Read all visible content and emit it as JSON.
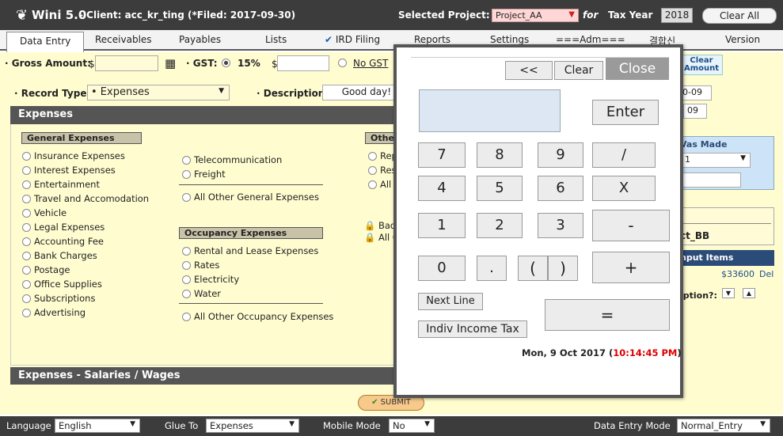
{
  "window": {
    "app_title": "Wini 5.0",
    "client_text": "- Client: acc_kr_ting (*Filed: 2017-09-30)",
    "selected_project_label": "Selected Project:",
    "selected_project_value": "Project_AA",
    "for_label": "for",
    "tax_year_label": "Tax Year",
    "tax_year_value": "2018",
    "clear_all_label": "Clear All"
  },
  "tabs": [
    {
      "label": "Data Entry"
    },
    {
      "label": "Receivables"
    },
    {
      "label": "Payables"
    },
    {
      "label": "Lists"
    },
    {
      "label": "IRD Filing"
    },
    {
      "label": "Reports"
    },
    {
      "label": "Settings"
    },
    {
      "label": "===Adm==="
    },
    {
      "label": "결합신"
    },
    {
      "label": "Version"
    }
  ],
  "form": {
    "gross_amount_label": "· Gross Amount:",
    "currency": "$",
    "gst_label": "· GST:",
    "gst_rate": "15%",
    "no_gst_label": "No GST",
    "clear_amount_label": "Clear Amount",
    "record_type_label": "· Record Type",
    "record_type_value": "• Expenses",
    "description_label": "· Description",
    "description_value": "Good day!"
  },
  "expenses": {
    "header": "Expenses",
    "general_header": "General Expenses",
    "general_col1": [
      "Insurance Expenses",
      "Interest Expenses",
      "Entertainment",
      "Travel and Accomodation",
      "Vehicle",
      "Legal Expenses",
      "Accounting Fee",
      "Bank Charges",
      "Postage",
      "Office Supplies",
      "Subscriptions",
      "Advertising"
    ],
    "general_col2": [
      "Telecommunication",
      "Freight"
    ],
    "all_other_general": "All Other General Expenses",
    "occupancy_header": "Occupancy Expenses",
    "occupancy_items": [
      "Rental and Lease Expenses",
      "Rates",
      "Electricity",
      "Water"
    ],
    "all_other_occupancy": "All Other Occupancy Expenses",
    "other_header_partial": "Othe",
    "other_items_partial": [
      "Rep",
      "Res",
      "All"
    ],
    "bad_partial": "Bad",
    "all_c_partial": "All C",
    "salaries_header": "Expenses - Salaries / Wages"
  },
  "side": {
    "date1": "0-09",
    "date2": "09",
    "was_made": "Vas Made",
    "select_val": "1",
    "ct_bb": "ct_BB",
    "input_items": "nput Items",
    "amount": "$33600",
    "del": "Del",
    "iption": "iption?:"
  },
  "submit_label": "SUBMIT",
  "footer": {
    "language_label": "Language",
    "language_value": "English",
    "glue_label": "Glue To",
    "glue_value": "Expenses",
    "mobile_label": "Mobile Mode",
    "mobile_value": "No",
    "dem_label": "Data Entry Mode",
    "dem_value": "Normal_Entry"
  },
  "calculator": {
    "back_label": "<<",
    "clear_label": "Clear",
    "close_label": "Close",
    "enter_label": "Enter",
    "keys": {
      "k7": "7",
      "k8": "8",
      "k9": "9",
      "div": "/",
      "k4": "4",
      "k5": "5",
      "k6": "6",
      "mul": "X",
      "k1": "1",
      "k2": "2",
      "k3": "3",
      "minus": "-",
      "k0": "0",
      "dot": ".",
      "lparen": "(",
      "rparen": ")",
      "plus": "+",
      "eq": "="
    },
    "next_line_label": "Next Line",
    "indiv_tax_label": "Indiv Income Tax",
    "date_text": "Mon, 9 Oct 2017",
    "time_text": "10:14:45 PM"
  }
}
